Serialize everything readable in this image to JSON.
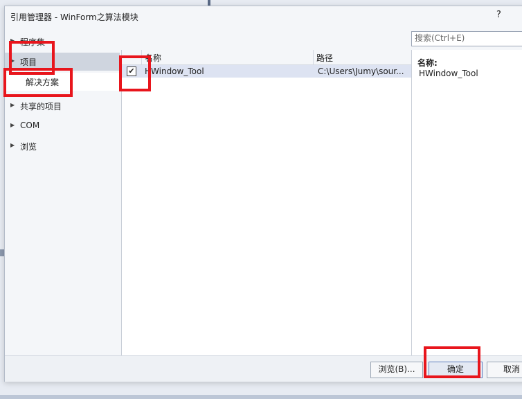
{
  "dialog": {
    "title": "引用管理器 - WinForm之算法模块",
    "help": "?"
  },
  "search": {
    "placeholder": "搜索(Ctrl+E)"
  },
  "nav": {
    "items": [
      {
        "label": "程序集",
        "icon": "expand-arrow-icon"
      },
      {
        "label": "项目",
        "icon": "expand-arrow-icon",
        "selected": true
      },
      {
        "label": "解决方案"
      },
      {
        "label": "共享的项目",
        "icon": "expand-arrow-icon"
      },
      {
        "label": "COM",
        "icon": "expand-arrow-icon"
      },
      {
        "label": "浏览",
        "icon": "expand-arrow-icon"
      }
    ]
  },
  "list": {
    "headers": [
      "名称",
      "路径"
    ],
    "rows": [
      {
        "checked": true,
        "check_glyph": "✔",
        "name": "HWindow_Tool",
        "path": "C:\\Users\\Jumy\\sour..."
      }
    ]
  },
  "detail": {
    "label": "名称:",
    "value": "HWindow_Tool"
  },
  "buttons": {
    "browse": "浏览(B)...",
    "ok": "确定",
    "cancel": "取消"
  },
  "colors": {
    "annotation": "#e8151c",
    "selection": "#cfd5df"
  }
}
